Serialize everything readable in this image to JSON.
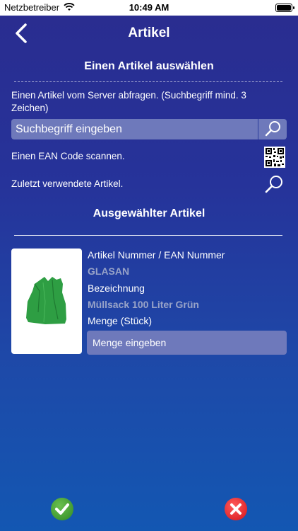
{
  "statusbar": {
    "carrier": "Netzbetreiber",
    "time": "10:49 AM"
  },
  "navbar": {
    "title": "Artikel"
  },
  "select_section": {
    "title": "Einen Artikel auswählen",
    "server_query_text": "Einen Artikel vom Server abfragen. (Suchbegriff mind. 3 Zeichen)",
    "search_placeholder": "Suchbegriff eingeben",
    "ean_scan_text": "Einen EAN Code scannen.",
    "recent_text": "Zuletzt verwendete Artikel."
  },
  "selected_section": {
    "title": "Ausgewählter Artikel",
    "article_number_label": "Artikel Nummer / EAN Nummer",
    "article_number_value": "GLASAN",
    "description_label": "Bezeichnung",
    "description_value": "Müllsack 100 Liter Grün",
    "quantity_label": "Menge (Stück)",
    "quantity_placeholder": "Menge eingeben"
  },
  "icons": {
    "back": "chevron-left-icon",
    "search": "magnifier-icon",
    "qr": "qr-code-icon",
    "confirm": "checkmark-icon",
    "cancel": "close-icon"
  },
  "colors": {
    "confirm": "#3fa02e",
    "cancel": "#e81c22",
    "input_bg": "#6e79bb"
  }
}
